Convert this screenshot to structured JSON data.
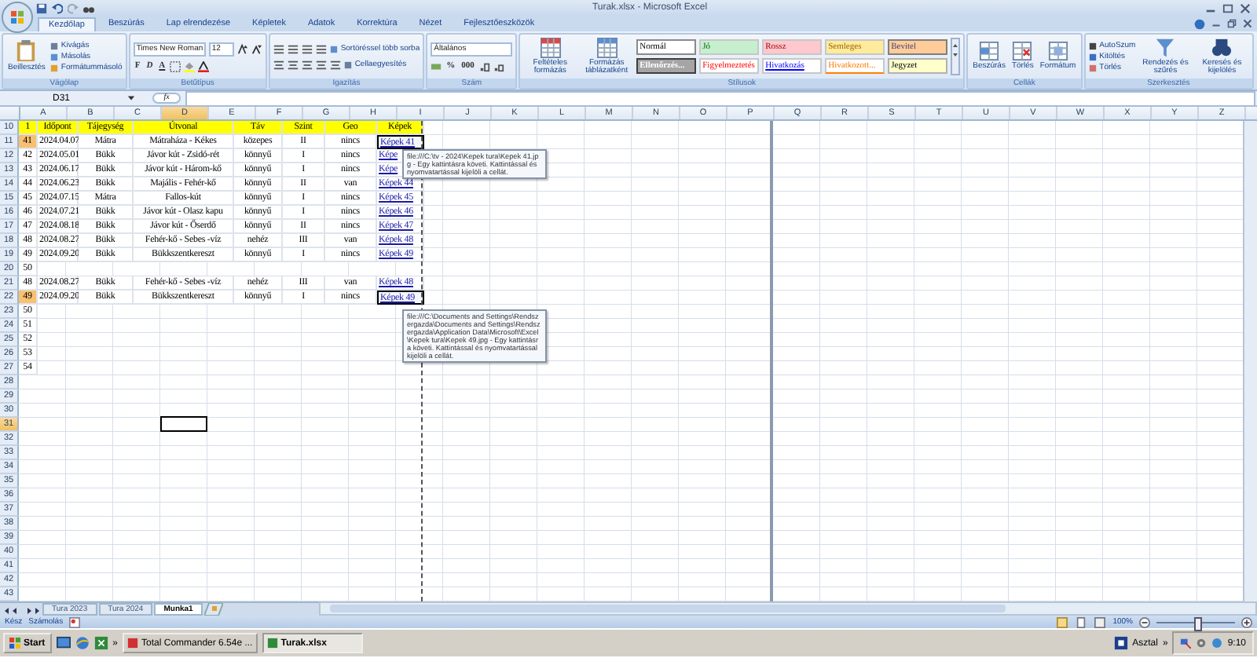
{
  "window": {
    "title": "Turak.xlsx - Microsoft Excel"
  },
  "tabs": [
    {
      "label": "Kezdőlap",
      "selected": true
    },
    {
      "label": "Beszúrás",
      "selected": false
    },
    {
      "label": "Lap elrendezése",
      "selected": false
    },
    {
      "label": "Képletek",
      "selected": false
    },
    {
      "label": "Adatok",
      "selected": false
    },
    {
      "label": "Korrektúra",
      "selected": false
    },
    {
      "label": "Nézet",
      "selected": false
    },
    {
      "label": "Fejlesztőeszközök",
      "selected": false
    }
  ],
  "ribbon": {
    "groups": [
      {
        "kind": "clipboard",
        "label": "Vágólap",
        "big": "Beillesztés",
        "small": [
          "Kivágás",
          "Másolás",
          "Formátummásoló"
        ]
      },
      {
        "kind": "font",
        "label": "Betűtípus",
        "font": "Times New Roman",
        "size": "12",
        "toggles": [
          "F",
          "D",
          "A"
        ]
      },
      {
        "kind": "alignment",
        "label": "Igazítás",
        "small": [
          "Sortöréssel több sorba",
          "Cellaegyesítés"
        ]
      },
      {
        "kind": "number",
        "label": "Szám",
        "format": "Általános",
        "symbols": [
          "%",
          "000"
        ]
      },
      {
        "kind": "styles",
        "label": "Stílusok",
        "big": [
          "Feltételes formázás",
          "Formázás táblázatként"
        ],
        "items": [
          {
            "label": "Normál",
            "kind": "normal"
          },
          {
            "label": "Jó",
            "kind": "good"
          },
          {
            "label": "Rossz",
            "kind": "bad"
          },
          {
            "label": "Semleges",
            "kind": "neutral"
          },
          {
            "label": "Bevitel",
            "kind": "input"
          },
          {
            "label": "Ellenőrzés...",
            "kind": "check"
          },
          {
            "label": "Figyelmeztetés",
            "kind": "warning"
          },
          {
            "label": "Hivatkozás",
            "kind": "link"
          },
          {
            "label": "Hivatkozott...",
            "kind": "followed"
          },
          {
            "label": "Jegyzet",
            "kind": "note"
          }
        ]
      },
      {
        "kind": "cells",
        "label": "Cellák",
        "big": [
          "Beszúrás",
          "Törlés",
          "Formátum"
        ]
      },
      {
        "kind": "editing",
        "label": "Szerkesztés",
        "small": [
          "AutoSzum",
          "Kitöltés",
          "Törlés"
        ],
        "big": [
          "Rendezés és szűrés",
          "Keresés és kijelölés"
        ]
      }
    ]
  },
  "formula_bar": {
    "name_box": "D31",
    "fx": "fx"
  },
  "columns": [
    {
      "label": "A",
      "selected": false
    },
    {
      "label": "B",
      "selected": false
    },
    {
      "label": "C",
      "selected": false
    },
    {
      "label": "D",
      "selected": true
    },
    {
      "label": "E",
      "selected": false
    },
    {
      "label": "F",
      "selected": false
    },
    {
      "label": "G",
      "selected": false
    },
    {
      "label": "H",
      "selected": false
    },
    {
      "label": "I",
      "selected": false
    },
    {
      "label": "J",
      "selected": false
    },
    {
      "label": "K",
      "selected": false
    },
    {
      "label": "L",
      "selected": false
    },
    {
      "label": "M",
      "selected": false
    },
    {
      "label": "N",
      "selected": false
    },
    {
      "label": "O",
      "selected": false
    },
    {
      "label": "P",
      "selected": false
    },
    {
      "label": "Q",
      "selected": false
    },
    {
      "label": "R",
      "selected": false
    },
    {
      "label": "S",
      "selected": false
    },
    {
      "label": "T",
      "selected": false
    },
    {
      "label": "U",
      "selected": false
    },
    {
      "label": "V",
      "selected": false
    },
    {
      "label": "W",
      "selected": false
    },
    {
      "label": "X",
      "selected": false
    },
    {
      "label": "Y",
      "selected": false
    },
    {
      "label": "Z",
      "selected": false
    }
  ],
  "rows": [
    {
      "row": "10",
      "kind": "header",
      "selected": false,
      "cells": [
        "1",
        "Időpont",
        "Tájegység",
        "Útvonal",
        "Táv",
        "Szint",
        "Geo",
        "Képek"
      ]
    },
    {
      "row": "11",
      "kind": "data",
      "selected": false,
      "marked": true,
      "link_selected": true,
      "cells": [
        "41",
        "2024.04.07",
        "Mátra",
        "Mátraháza - Kékes",
        "közepes",
        "II",
        "nincs",
        "Képek 41"
      ]
    },
    {
      "row": "12",
      "kind": "data",
      "selected": false,
      "marked": false,
      "link_selected": false,
      "cells": [
        "42",
        "2024.05.01",
        "Bükk",
        "Jávor kút - Zsidó-rét",
        "könnyű",
        "I",
        "nincs",
        "Képe"
      ]
    },
    {
      "row": "13",
      "kind": "data",
      "selected": false,
      "marked": false,
      "link_selected": false,
      "cells": [
        "43",
        "2024.06.17",
        "Bükk",
        "Jávor kút - Három-kő",
        "könnyű",
        "I",
        "nincs",
        "Képe"
      ]
    },
    {
      "row": "14",
      "kind": "data",
      "selected": false,
      "marked": false,
      "link_selected": false,
      "cells": [
        "44",
        "2024.06.23",
        "Bükk",
        "Majális - Fehér-kő",
        "könnyű",
        "II",
        "van",
        "Képek 44"
      ]
    },
    {
      "row": "15",
      "kind": "data",
      "selected": false,
      "marked": false,
      "link_selected": false,
      "cells": [
        "45",
        "2024.07.15",
        "Mátra",
        "Fallos-kút",
        "könnyű",
        "I",
        "nincs",
        "Képek 45"
      ]
    },
    {
      "row": "16",
      "kind": "data",
      "selected": false,
      "marked": false,
      "link_selected": false,
      "cells": [
        "46",
        "2024.07.21",
        "Bükk",
        "Jávor kút - Olasz kapu",
        "könnyű",
        "I",
        "nincs",
        "Képek 46"
      ]
    },
    {
      "row": "17",
      "kind": "data",
      "selected": false,
      "marked": false,
      "link_selected": false,
      "cells": [
        "47",
        "2024.08.18",
        "Bükk",
        "Jávor kút - Őserdő",
        "könnyű",
        "II",
        "nincs",
        "Képek 47"
      ]
    },
    {
      "row": "18",
      "kind": "data",
      "selected": false,
      "marked": false,
      "link_selected": false,
      "cells": [
        "48",
        "2024.08.27",
        "Bükk",
        "Fehér-kő - Sebes -víz",
        "nehéz",
        "III",
        "van",
        "Képek 48"
      ]
    },
    {
      "row": "19",
      "kind": "data",
      "selected": false,
      "marked": false,
      "link_selected": false,
      "cells": [
        "49",
        "2024.09.20",
        "Bükk",
        "Bükkszentkereszt",
        "könnyű",
        "I",
        "nincs",
        "Képek 49"
      ]
    },
    {
      "row": "20",
      "kind": "data",
      "selected": false,
      "marked": false,
      "cells": [
        "50"
      ]
    },
    {
      "row": "21",
      "kind": "data",
      "selected": false,
      "marked": false,
      "link_selected": false,
      "cells": [
        "48",
        "2024.08.27",
        "Bükk",
        "Fehér-kő - Sebes -víz",
        "nehéz",
        "III",
        "van",
        "Képek 48"
      ]
    },
    {
      "row": "22",
      "kind": "data",
      "selected": false,
      "marked": true,
      "link_selected": true,
      "cells": [
        "49",
        "2024.09.20",
        "Bükk",
        "Bükkszentkereszt",
        "könnyű",
        "I",
        "nincs",
        "Képek 49"
      ]
    },
    {
      "row": "23",
      "kind": "data",
      "selected": false,
      "marked": false,
      "cells": [
        "50"
      ]
    },
    {
      "row": "24",
      "kind": "data",
      "selected": false,
      "marked": false,
      "cells": [
        "51"
      ]
    },
    {
      "row": "25",
      "kind": "data",
      "selected": false,
      "marked": false,
      "cells": [
        "52"
      ]
    },
    {
      "row": "26",
      "kind": "data",
      "selected": false,
      "marked": false,
      "cells": [
        "53"
      ]
    },
    {
      "row": "27",
      "kind": "data",
      "selected": false,
      "marked": false,
      "cells": [
        "54"
      ]
    },
    {
      "row": "28",
      "kind": "blank",
      "selected": false
    },
    {
      "row": "29",
      "kind": "blank",
      "selected": false
    },
    {
      "row": "30",
      "kind": "blank",
      "selected": false
    },
    {
      "row": "31",
      "kind": "blank",
      "selected": true
    },
    {
      "row": "32",
      "kind": "blank",
      "selected": false
    },
    {
      "row": "33",
      "kind": "blank",
      "selected": false
    },
    {
      "row": "34",
      "kind": "blank",
      "selected": false
    },
    {
      "row": "35",
      "kind": "blank",
      "selected": false
    },
    {
      "row": "36",
      "kind": "blank",
      "selected": false
    },
    {
      "row": "37",
      "kind": "blank",
      "selected": false
    },
    {
      "row": "38",
      "kind": "blank",
      "selected": false
    },
    {
      "row": "39",
      "kind": "blank",
      "selected": false
    },
    {
      "row": "40",
      "kind": "blank",
      "selected": false
    },
    {
      "row": "41",
      "kind": "blank",
      "selected": false
    },
    {
      "row": "42",
      "kind": "blank",
      "selected": false
    },
    {
      "row": "43",
      "kind": "blank",
      "selected": false
    }
  ],
  "tooltips": [
    {
      "text": "file:///C:\\tv - 2024\\Kepek tura\\Kepek 41.jpg - Egy kattintásra követi. Kattintással és nyomvatartással kijelöli a cellát."
    },
    {
      "text": "file:///C:\\Documents and Settings\\Rendszergazda\\Documents and Settings\\Rendszergazda\\Application Data\\Microsoft\\Excel\\Kepek tura\\Kepek 49.jpg - Egy kattintásra követi. Kattintással és nyomvatartással kijelöli a cellát."
    }
  ],
  "sheet_tabs": [
    {
      "label": "Tura 2023",
      "selected": false
    },
    {
      "label": "Tura 2024",
      "selected": false
    },
    {
      "label": "Munka1",
      "selected": true
    }
  ],
  "status_bar": {
    "mode": "Kész",
    "calc": "Számolás",
    "zoom": "100%",
    "zoom_slider": {
      "level": 0.5
    }
  },
  "taskbar": {
    "start": "Start",
    "more": "»",
    "tasks": [
      {
        "label": "Total Commander 6.54e ...",
        "selected": false
      },
      {
        "label": "Turak.xlsx",
        "selected": true
      }
    ],
    "desktop": "Asztal",
    "tray_more": "»",
    "clock": "9:10"
  }
}
